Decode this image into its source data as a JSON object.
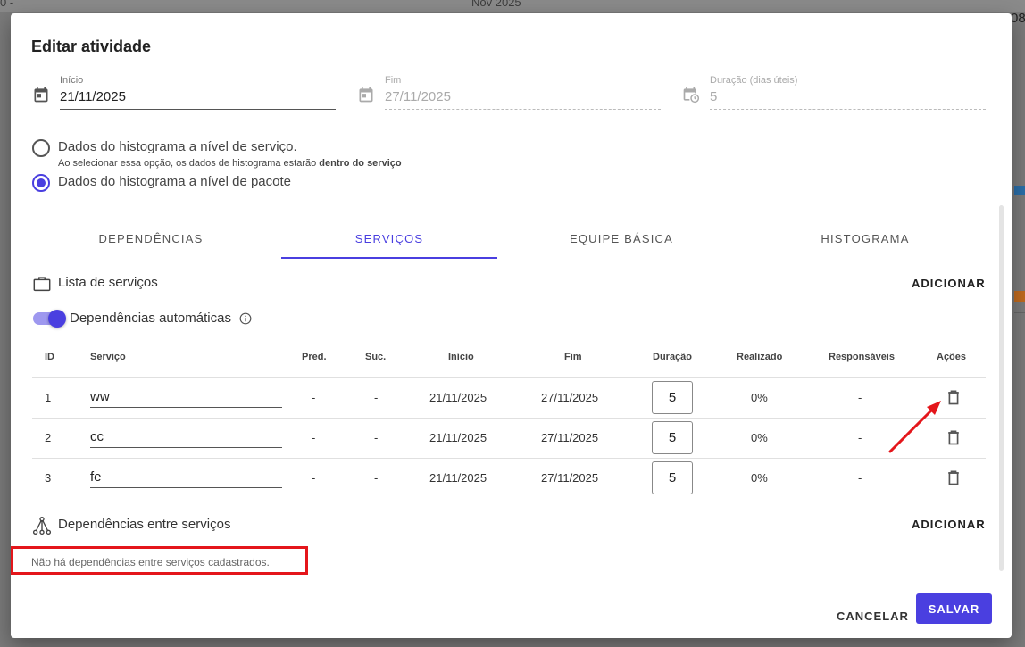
{
  "backdrop": {
    "month_label": "Nov 2025",
    "left_edge_text": "0 -",
    "right_edge_text": "08"
  },
  "dialog": {
    "title": "Editar atividade"
  },
  "fields": {
    "start": {
      "label": "Início",
      "value": "21/11/2025",
      "icon": "calendar-icon"
    },
    "end": {
      "label": "Fim",
      "value": "27/11/2025",
      "icon": "calendar-icon"
    },
    "duration": {
      "label": "Duração (dias úteis)",
      "value": "5",
      "icon": "calendar-clock-icon"
    }
  },
  "histogram_options": {
    "service_level": {
      "label": "Dados do histograma a nível de serviço.",
      "help_prefix": "Ao selecionar essa opção, os dados de histograma estarão ",
      "help_bold": "dentro do serviço",
      "checked": false
    },
    "package_level": {
      "label": "Dados do histograma a nível de pacote",
      "checked": true
    }
  },
  "tabs": [
    {
      "label": "DEPENDÊNCIAS",
      "active": false
    },
    {
      "label": "SERVIÇOS",
      "active": true
    },
    {
      "label": "EQUIPE BÁSICA",
      "active": false
    },
    {
      "label": "HISTOGRAMA",
      "active": false
    }
  ],
  "services_section": {
    "title": "Lista de serviços",
    "icon": "briefcase-icon",
    "add_label": "ADICIONAR",
    "auto_deps_label": "Dependências automáticas",
    "auto_deps_on": true
  },
  "table": {
    "headers": {
      "id": "ID",
      "service": "Serviço",
      "pred": "Pred.",
      "suc": "Suc.",
      "start": "Início",
      "end": "Fim",
      "duration": "Duração",
      "done": "Realizado",
      "owners": "Responsáveis",
      "actions": "Ações"
    },
    "rows": [
      {
        "id": "1",
        "service": "ww",
        "pred": "-",
        "suc": "-",
        "start": "21/11/2025",
        "end": "27/11/2025",
        "duration": "5",
        "done": "0%",
        "owners": "-"
      },
      {
        "id": "2",
        "service": "cc",
        "pred": "-",
        "suc": "-",
        "start": "21/11/2025",
        "end": "27/11/2025",
        "duration": "5",
        "done": "0%",
        "owners": "-"
      },
      {
        "id": "3",
        "service": "fe",
        "pred": "-",
        "suc": "-",
        "start": "21/11/2025",
        "end": "27/11/2025",
        "duration": "5",
        "done": "0%",
        "owners": "-"
      }
    ]
  },
  "dependencies_section": {
    "title": "Dependências entre serviços",
    "icon": "hierarchy-icon",
    "add_label": "ADICIONAR",
    "empty_message": "Não há dependências entre serviços cadastrados."
  },
  "footer": {
    "cancel_label": "CANCELAR",
    "save_label": "SALVAR"
  },
  "colors": {
    "accent": "#4a3fe0",
    "annotation": "#e4161b"
  }
}
